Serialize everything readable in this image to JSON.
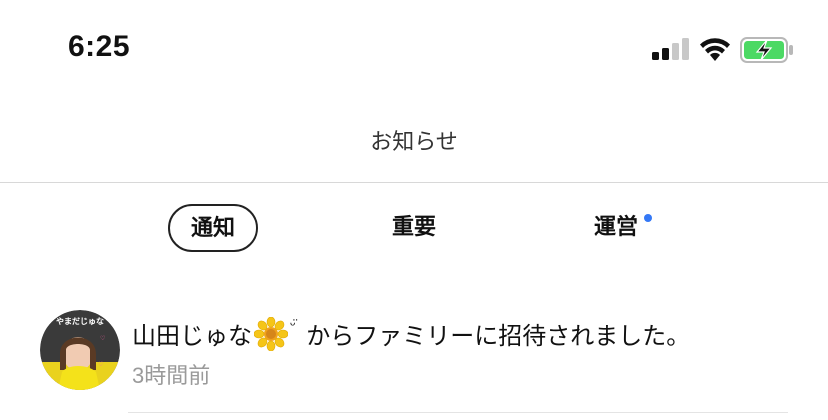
{
  "status_bar": {
    "time": "6:25",
    "signal_icon": "cellular-signal-icon",
    "wifi_icon": "wifi-icon",
    "battery_icon": "battery-charging-icon",
    "battery_color": "#4cd964"
  },
  "header": {
    "title": "お知らせ"
  },
  "tabs": [
    {
      "label": "通知",
      "active": true
    },
    {
      "label": "重要",
      "active": false
    },
    {
      "label": "運営",
      "active": false,
      "has_badge": true
    }
  ],
  "badge_color": "#3478f6",
  "notifications": [
    {
      "user_name": "山田じゅな",
      "name_suffix": "ᵕ̈",
      "message": "からファミリーに招待されました。",
      "time": "3時間前",
      "avatar_icon": "user-avatar-image",
      "avatar_text": "やまだじゅな"
    }
  ]
}
